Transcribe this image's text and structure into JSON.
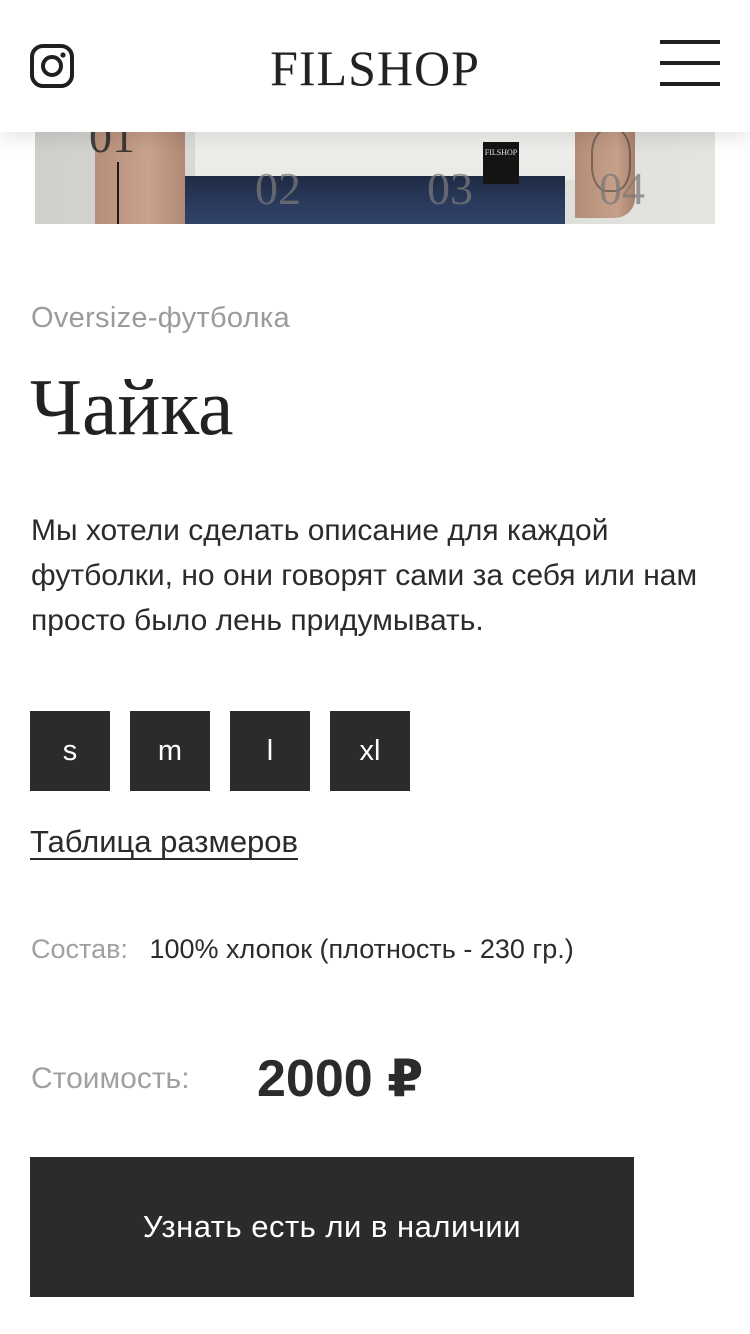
{
  "header": {
    "logo": "FILSHOP",
    "instagram_icon": "instagram-icon",
    "menu_icon": "hamburger-menu-icon"
  },
  "gallery": {
    "slides": [
      "01",
      "02",
      "03",
      "04"
    ],
    "active_slide": "01",
    "label_text": "FILSHOP"
  },
  "product": {
    "category": "Oversize-футболка",
    "title": "Чайка",
    "description": "Мы хотели сделать описание для каждой футболки, но они говорят сами за себя или нам просто было лень придумывать.",
    "sizes": [
      "s",
      "m",
      "l",
      "xl"
    ],
    "size_table_link": "Таблица размеров",
    "composition_label": "Состав:",
    "composition_value": "100% хлопок (плотность - 230 гр.)",
    "price_label": "Стоимость:",
    "price_value": "2000 ₽",
    "cta_label": "Узнать есть ли в наличии"
  },
  "colors": {
    "dark": "#2b2b2b",
    "muted": "#9b9b9b",
    "background": "#ffffff"
  }
}
